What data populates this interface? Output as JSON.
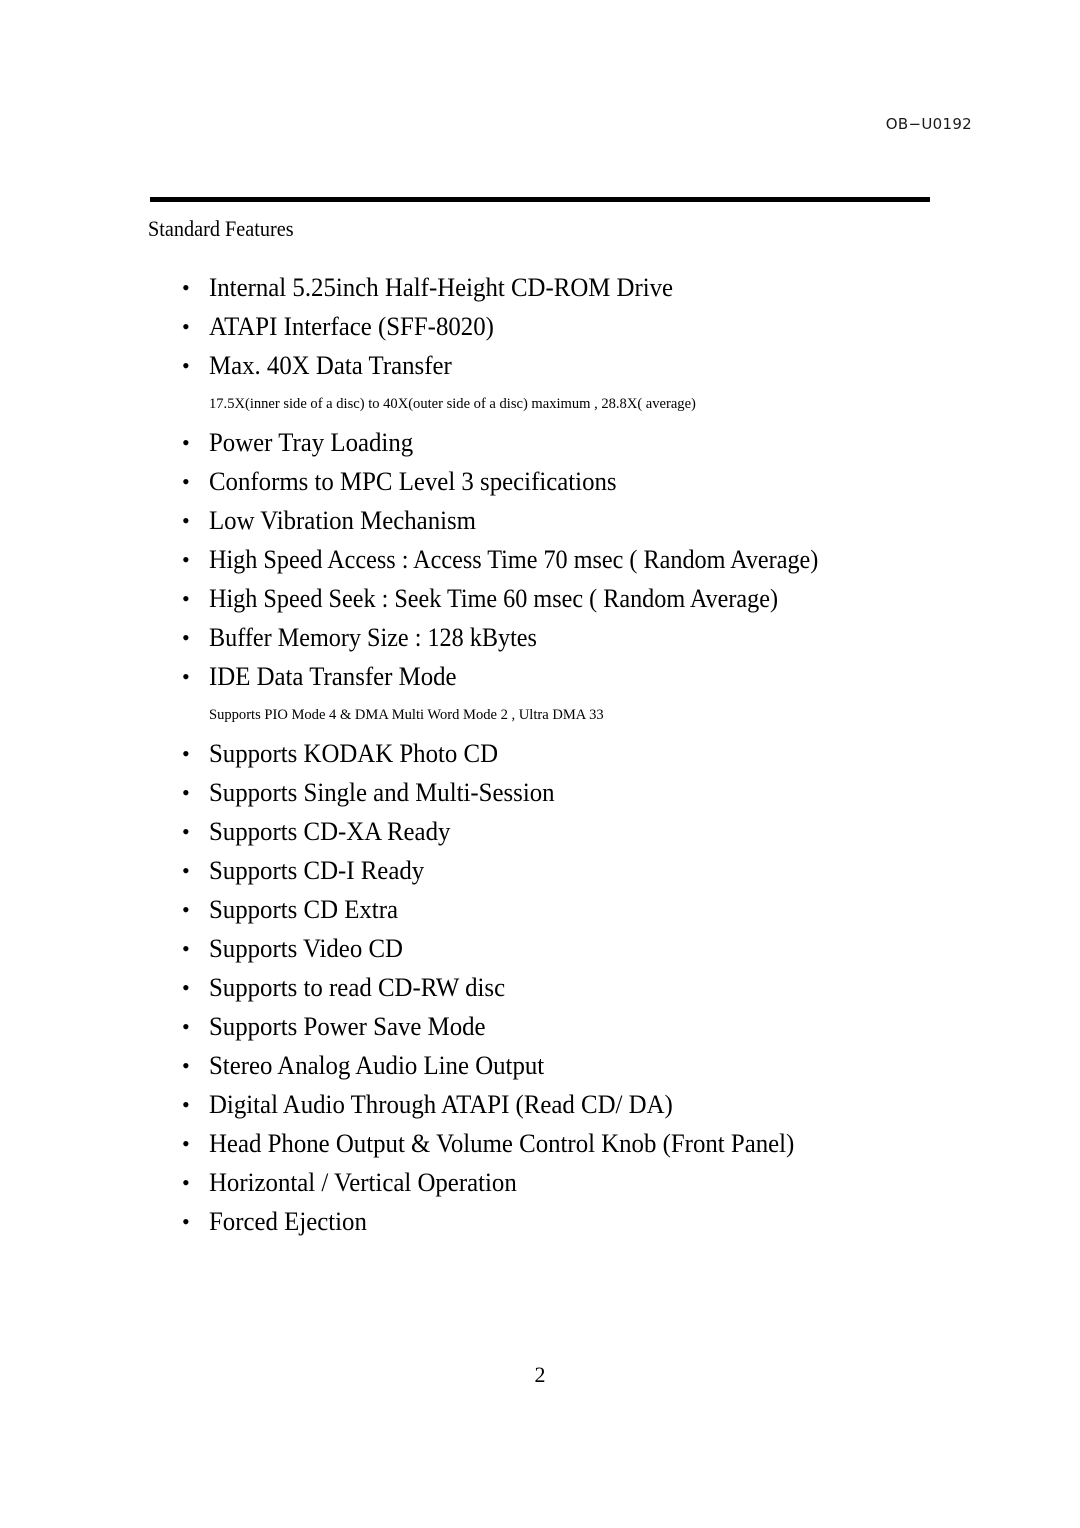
{
  "header": {
    "doc_code": "OB−U0192"
  },
  "section": {
    "title": "Standard Features"
  },
  "bullet_glyph": "•",
  "features": [
    {
      "kind": "item",
      "text": "Internal 5.25inch Half-Height CD-ROM Drive"
    },
    {
      "kind": "item",
      "text": "ATAPI Interface (SFF-8020)"
    },
    {
      "kind": "item",
      "text": "Max. 40X Data Transfer"
    },
    {
      "kind": "note",
      "text": "17.5X(inner side of a disc) to 40X(outer side of a disc) maximum , 28.8X( average)"
    },
    {
      "kind": "item",
      "text": "Power Tray Loading"
    },
    {
      "kind": "item",
      "text": "Conforms to MPC Level 3 specifications"
    },
    {
      "kind": "item",
      "text": "Low Vibration Mechanism"
    },
    {
      "kind": "item",
      "condensed": true,
      "text": "High Speed Access :     Access Time     70 msec ( Random Average)"
    },
    {
      "kind": "item",
      "condensed": true,
      "text": "High Speed Seek    :     Seek Time     60 msec ( Random Average)"
    },
    {
      "kind": "item",
      "condensed": true,
      "text": "Buffer Memory Size :     128 kBytes"
    },
    {
      "kind": "item",
      "text": "IDE Data Transfer Mode"
    },
    {
      "kind": "note",
      "text": "Supports PIO Mode 4 & DMA Multi Word Mode 2 , Ultra DMA 33"
    },
    {
      "kind": "item",
      "text": "Supports KODAK Photo CD"
    },
    {
      "kind": "item",
      "text": "Supports Single and Multi-Session"
    },
    {
      "kind": "item",
      "text": "Supports CD-XA Ready"
    },
    {
      "kind": "item",
      "text": "Supports CD-I Ready"
    },
    {
      "kind": "item",
      "text": "Supports CD Extra"
    },
    {
      "kind": "item",
      "text": "Supports Video CD"
    },
    {
      "kind": "item",
      "text": "Supports to read CD-RW disc"
    },
    {
      "kind": "item",
      "text": "Supports Power Save Mode"
    },
    {
      "kind": "item",
      "text": "Stereo Analog Audio Line Output"
    },
    {
      "kind": "item",
      "text": "Digital Audio Through ATAPI (Read CD/ DA)"
    },
    {
      "kind": "item",
      "text": "Head Phone Output & Volume Control Knob     (Front Panel)"
    },
    {
      "kind": "item",
      "text": "Horizontal /  Vertical Operation"
    },
    {
      "kind": "item",
      "text": "Forced Ejection"
    }
  ],
  "footer": {
    "page_number": "2"
  },
  "colors": {
    "text": "#000000",
    "rule": "#000000",
    "background": "#ffffff"
  }
}
